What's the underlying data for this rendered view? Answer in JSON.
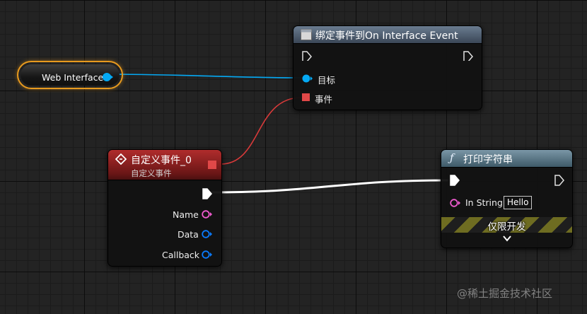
{
  "colors": {
    "exec_wire": "#ffffff",
    "object_wire": "#04a9f4",
    "delegate_wire": "#d83a3a",
    "string_pin": "#f05bd0",
    "struct_pin": "#0a7cff",
    "variable_outline": "#e89a1e"
  },
  "variable_node": {
    "label": "Web Interface"
  },
  "bind_node": {
    "icon": "graph-node-icon",
    "title": "绑定事件到On Interface Event",
    "target_label": "目标",
    "event_label": "事件"
  },
  "custom_event_node": {
    "icon": "event-diamond-icon",
    "title": "自定义事件_0",
    "subtitle": "自定义事件",
    "pins": [
      "Name",
      "Data",
      "Callback"
    ]
  },
  "print_node": {
    "icon": "function-icon",
    "title": "打印字符串",
    "in_string_label": "In String",
    "in_string_value": "Hello",
    "dev_only_label": "仅限开发",
    "expand_icon": "chevron-down-icon"
  },
  "watermark": "@稀土掘金技术社区"
}
